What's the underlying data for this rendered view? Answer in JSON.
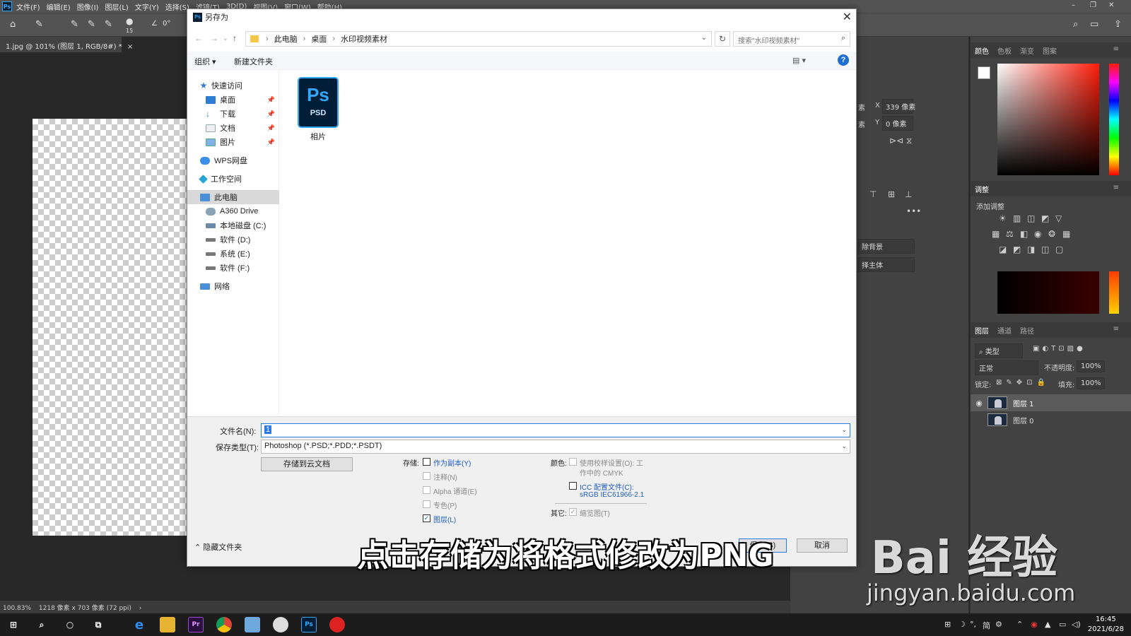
{
  "app": {
    "logo": "Ps",
    "menus": [
      "文件(F)",
      "编辑(E)",
      "图像(I)",
      "图层(L)",
      "文字(Y)",
      "选择(S)",
      "滤镜(T)",
      "3D(D)",
      "视图(V)",
      "窗口(W)",
      "帮助(H)"
    ],
    "brush_size": "15",
    "angle": "0°",
    "doc_tab": "1.jpg @ 101% (图层 1, RGB/8#) *",
    "status_zoom": "100.83%",
    "status_info": "1218 像素 x 703 像素 (72 ppi)"
  },
  "properties": {
    "x_label": "X",
    "x_value": "339 像素",
    "y_label": "Y",
    "y_value": "0 像素",
    "unit_left_1": "素",
    "unit_left_2": "素",
    "btn_bg": "除背景",
    "btn_subject": "择主体"
  },
  "right_panel": {
    "color_tabs": [
      "颜色",
      "色板",
      "渐变",
      "图案"
    ],
    "adjust_tab": "调整",
    "add_adjust": "添加调整",
    "layers_tabs": [
      "图层",
      "通道",
      "路径"
    ],
    "filter_kind": "类型",
    "blend_mode": "正常",
    "opacity_label": "不透明度:",
    "opacity_value": "100%",
    "lock_label": "锁定:",
    "fill_label": "填充:",
    "fill_value": "100%",
    "layers": [
      {
        "name": "图层 1"
      },
      {
        "name": "图层 0"
      }
    ]
  },
  "dialog": {
    "title": "另存为",
    "breadcrumb": [
      "此电脑",
      "桌面",
      "水印视频素材"
    ],
    "search_placeholder": "搜索\"水印视频素材\"",
    "organize": "组织 ▾",
    "new_folder": "新建文件夹",
    "help": "?",
    "nav": [
      {
        "label": "快速访问",
        "icon": "star-icon",
        "pinned": false
      },
      {
        "label": "桌面",
        "icon": "desktop-icon",
        "pinned": true
      },
      {
        "label": "下载",
        "icon": "download-icon",
        "pinned": true
      },
      {
        "label": "文档",
        "icon": "document-icon",
        "pinned": true
      },
      {
        "label": "图片",
        "icon": "picture-icon",
        "pinned": true
      },
      {
        "label": "WPS网盘",
        "icon": "cloud-icon",
        "pinned": false
      },
      {
        "label": "工作空间",
        "icon": "workspace-icon",
        "pinned": false
      },
      {
        "label": "此电脑",
        "icon": "computer-icon",
        "pinned": false
      },
      {
        "label": "A360 Drive",
        "icon": "drive-icon",
        "pinned": false
      },
      {
        "label": "本地磁盘 (C:)",
        "icon": "disk-icon",
        "pinned": false
      },
      {
        "label": "软件 (D:)",
        "icon": "disk-icon",
        "pinned": false
      },
      {
        "label": "系统 (E:)",
        "icon": "disk-icon",
        "pinned": false
      },
      {
        "label": "软件 (F:)",
        "icon": "disk-icon",
        "pinned": false
      },
      {
        "label": "网络",
        "icon": "network-icon",
        "pinned": false
      }
    ],
    "file": {
      "icon_big": "Ps",
      "icon_small": "PSD",
      "name": "相片"
    },
    "filename_label": "文件名(N):",
    "filename_value": "1",
    "filetype_label": "保存类型(T):",
    "filetype_value": "Photoshop (*.PSD;*.PDD;*.PSDT)",
    "cloud_save": "存储到云文档",
    "save_label": "存储:",
    "as_copy": "作为副本(Y)",
    "notes": "注释(N)",
    "alpha": "Alpha 通道(E)",
    "spot": "专色(P)",
    "layers_opt": "图层(L)",
    "color_label": "颜色:",
    "proof_line1": "使用校样设置(O):  工",
    "proof_line2": "作中的 CMYK",
    "icc_line1": "ICC 配置文件(C):",
    "icc_line2": "sRGB IEC61966-2.1",
    "other_label": "其它:",
    "thumbnail": "缩览图(T)",
    "hide_folders": "隐藏文件夹",
    "save_btn": "保存(S)",
    "cancel_btn": "取消"
  },
  "overlay": {
    "subtitle": "点击存储为将格式修改为PNG",
    "watermark_logo": "Bai 经验",
    "watermark_url": "jingyan.baidu.com"
  },
  "taskbar": {
    "time": "16:45",
    "date": "2021/6/28",
    "ime": "简"
  }
}
